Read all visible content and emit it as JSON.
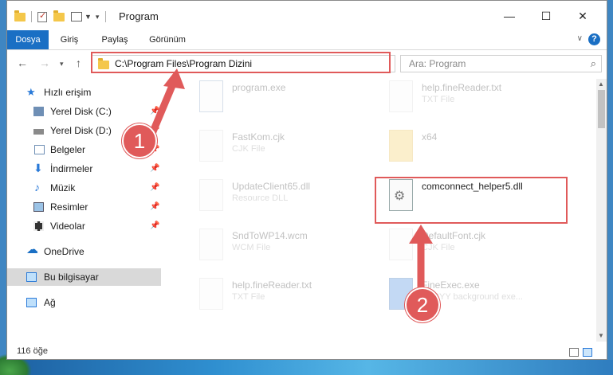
{
  "window": {
    "title": "Program"
  },
  "ribbon": {
    "tabs": [
      "Dosya",
      "Giriş",
      "Paylaş",
      "Görünüm"
    ]
  },
  "address": {
    "path": "C:\\Program Files\\Program Dizini"
  },
  "search": {
    "placeholder": "Ara: Program"
  },
  "sidebar": {
    "items": [
      {
        "label": "Hızlı erişim",
        "icon": "star-icon"
      },
      {
        "label": "Yerel Disk (C:)",
        "icon": "drive-icon"
      },
      {
        "label": "Yerel Disk (D:)",
        "icon": "drive-icon"
      },
      {
        "label": "Belgeler",
        "icon": "documents-icon"
      },
      {
        "label": "İndirmeler",
        "icon": "download-icon"
      },
      {
        "label": "Müzik",
        "icon": "music-icon"
      },
      {
        "label": "Resimler",
        "icon": "pictures-icon"
      },
      {
        "label": "Videolar",
        "icon": "video-icon"
      },
      {
        "label": "OneDrive",
        "icon": "cloud-icon"
      },
      {
        "label": "Bu bilgisayar",
        "icon": "computer-icon"
      },
      {
        "label": "Ağ",
        "icon": "network-icon"
      }
    ]
  },
  "files": [
    {
      "name": "program.exe",
      "type": ""
    },
    {
      "name": "help.fineReader.txt",
      "type": "TXT File"
    },
    {
      "name": "FastKom.cjk",
      "type": "CJK File"
    },
    {
      "name": "x64",
      "type": ""
    },
    {
      "name": "UpdateClient65.dll",
      "type": "Resource DLL"
    },
    {
      "name": "comconnect_helper5.dll",
      "type": ""
    },
    {
      "name": "SndToWP14.wcm",
      "type": "WCM File"
    },
    {
      "name": "DefaultFont.cjk",
      "type": "CJK File"
    },
    {
      "name": "help.fineReader.txt",
      "type": "TXT File"
    },
    {
      "name": "FineExec.exe",
      "type": "ABBYY background exe..."
    }
  ],
  "status": {
    "count": "116 öğe"
  },
  "callouts": {
    "step1": "1",
    "step2": "2"
  },
  "colors": {
    "accent": "#1a6fc4",
    "highlight": "#e05a5a"
  }
}
